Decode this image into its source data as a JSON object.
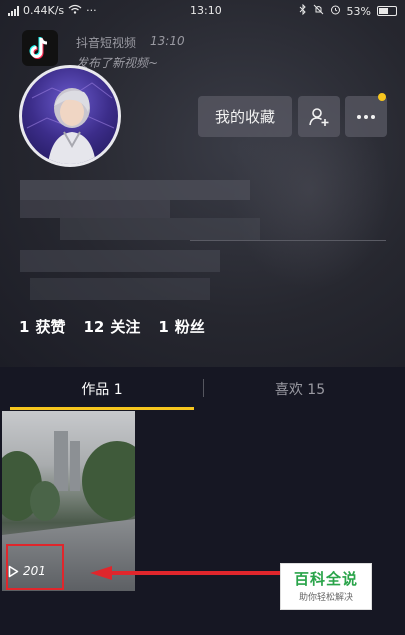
{
  "status_bar": {
    "network_speed": "0.44K/s",
    "time": "13:10",
    "battery": "53%"
  },
  "notification": {
    "app_name": "抖音短视频",
    "time": "13:10",
    "message": "发布了新视频~"
  },
  "profile": {
    "favorites_button": "我的收藏"
  },
  "stats": {
    "likes_count": "1",
    "likes_label": "获赞",
    "following_count": "12",
    "following_label": "关注",
    "followers_count": "1",
    "followers_label": "粉丝"
  },
  "tabs": {
    "works": "作品 1",
    "likes": "喜欢 15",
    "active": "works"
  },
  "videos": [
    {
      "play_count": "201"
    }
  ],
  "watermark": {
    "title": "百科全说",
    "subtitle": "助你轻松解决"
  },
  "colors": {
    "accent": "#f7c61e",
    "highlight": "#e0262c",
    "background": "#161723"
  }
}
